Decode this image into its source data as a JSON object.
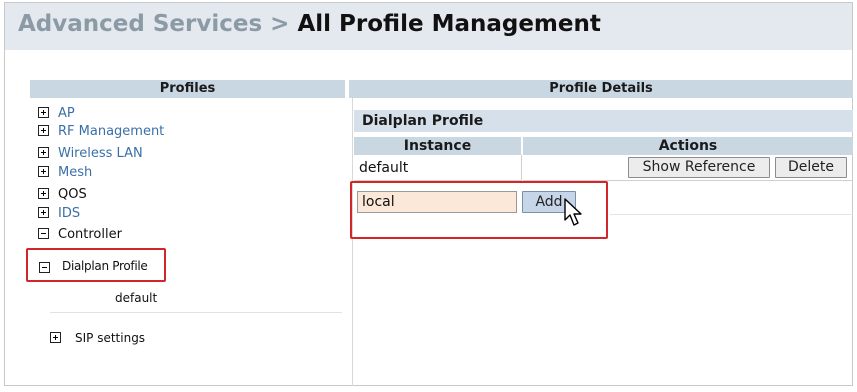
{
  "header": {
    "parent": "Advanced Services",
    "separator": ">",
    "current": "All Profile Management"
  },
  "profiles_panel": {
    "title": "Profiles",
    "items": [
      {
        "label": "AP",
        "expanded": false
      },
      {
        "label": "RF Management",
        "expanded": false
      },
      {
        "label": "Wireless LAN",
        "expanded": false
      },
      {
        "label": "Mesh",
        "expanded": false
      },
      {
        "label": "QOS",
        "expanded": false
      },
      {
        "label": "IDS",
        "expanded": false
      },
      {
        "label": "Controller",
        "expanded": true
      }
    ],
    "dialplan": {
      "label": "Dialplan Profile",
      "expanded": true,
      "child": "default"
    },
    "sip": {
      "label": "SIP settings",
      "expanded": false
    }
  },
  "details_panel": {
    "title": "Profile Details",
    "section_title": "Dialplan Profile",
    "columns": {
      "instance": "Instance",
      "actions": "Actions"
    },
    "rows": [
      {
        "instance": "default",
        "show_reference": "Show Reference",
        "delete": "Delete"
      }
    ],
    "new_instance": {
      "value": "local",
      "add_label": "Add"
    }
  },
  "colors": {
    "highlight": "#d3262a",
    "link": "#3a6fa8",
    "header_bg": "#c9d7e3",
    "input_bg": "#fce8d8"
  }
}
